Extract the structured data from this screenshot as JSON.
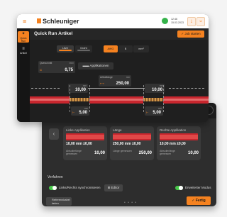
{
  "back_screen": {
    "cards": [
      {
        "title": "Linke Applikation",
        "value": "10,00 mm ±0,00",
        "sub_label": "Abisolierlänge gemessen",
        "sub_value": "10,00"
      },
      {
        "title": "Länge",
        "value": "250,00 mm ±0,00",
        "sub_label": "Länge gemessen",
        "sub_value": "250,00"
      },
      {
        "title": "Rechte Applikation",
        "value": "10,00 mm ±0,00",
        "sub_label": "Abisolierlänge gemessen",
        "sub_value": "10,00"
      }
    ],
    "section_label": "Verfahren",
    "toggle_sync_label": "Links/Rechts synchronisieren",
    "editor_label": "Editor",
    "toggle_extended_label": "Erweiterter Modus",
    "reference_label_line1": "Referenzkabel",
    "reference_label_line2": "laden",
    "pager_dots": "• • • •",
    "done_label": "Fertig"
  },
  "header": {
    "brand": "Schleuniger",
    "time": "12:46",
    "date": "15.03.2023"
  },
  "sidebar": {
    "items": [
      "Quick Run",
      "Artikel"
    ]
  },
  "main": {
    "title": "Quick Run Artikel",
    "job_button": "Job starten",
    "left_toggle": [
      "Litze",
      "Draht"
    ],
    "right_toggle": [
      "AWG",
      "B",
      "mm²"
    ],
    "cross_section": {
      "label": "Querschnitt",
      "unit": "mm²",
      "value": "0,75"
    },
    "applications_button": "Applikationen",
    "length": {
      "label": "Artikellänge",
      "unit": "mm",
      "value": "250,00"
    },
    "left_strip": {
      "unit": "mm",
      "value": "10,00"
    },
    "right_strip": {
      "unit": "mm",
      "value": "10,00"
    },
    "left_pull": {
      "unit": "mm",
      "value": "5,00"
    },
    "right_pull": {
      "unit": "mm",
      "value": "5,00"
    }
  },
  "colors": {
    "accent": "#f58220",
    "cable": "#c8262e",
    "ok": "#35b24a"
  }
}
